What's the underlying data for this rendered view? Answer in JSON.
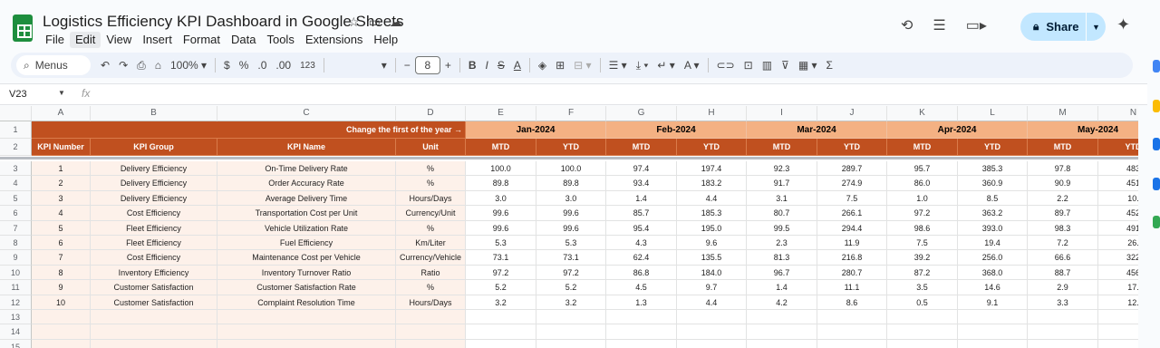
{
  "doc": {
    "title": "Logistics Efficiency KPI Dashboard in Google Sheets"
  },
  "menu": [
    "File",
    "Edit",
    "View",
    "Insert",
    "Format",
    "Data",
    "Tools",
    "Extensions",
    "Help"
  ],
  "share": {
    "label": "Share"
  },
  "toolbar": {
    "menus": "Menus",
    "zoom": "100%",
    "currency": "$",
    "percent": "%",
    "dec_dec": ".0",
    "dec_inc": ".00",
    "number_format": "123",
    "font_size": "8"
  },
  "formula_bar": {
    "cell_ref": "V23",
    "fx": "fx"
  },
  "columns": [
    "A",
    "B",
    "C",
    "D",
    "E",
    "F",
    "G",
    "H",
    "I",
    "J",
    "K",
    "L",
    "M",
    "N"
  ],
  "banner": {
    "text": "Change the first of the year →"
  },
  "months": [
    "Jan-2024",
    "Feb-2024",
    "Mar-2024",
    "Apr-2024",
    "May-2024"
  ],
  "headers": {
    "kpi_number": "KPI Number",
    "kpi_group": "KPI Group",
    "kpi_name": "KPI Name",
    "unit": "Unit",
    "mtd": "MTD",
    "ytd": "YTD"
  },
  "row_numbers": [
    "1",
    "2",
    "3",
    "4",
    "5",
    "6",
    "7",
    "8",
    "9",
    "10",
    "11",
    "12",
    "13",
    "14",
    "15"
  ],
  "rows": [
    {
      "num": "1",
      "group": "Delivery Efficiency",
      "name": "On-Time Delivery Rate",
      "unit": "%",
      "vals": [
        "100.0",
        "100.0",
        "97.4",
        "197.4",
        "92.3",
        "289.7",
        "95.7",
        "385.3",
        "97.8",
        "483"
      ]
    },
    {
      "num": "2",
      "group": "Delivery Efficiency",
      "name": "Order Accuracy Rate",
      "unit": "%",
      "vals": [
        "89.8",
        "89.8",
        "93.4",
        "183.2",
        "91.7",
        "274.9",
        "86.0",
        "360.9",
        "90.9",
        "451"
      ]
    },
    {
      "num": "3",
      "group": "Delivery Efficiency",
      "name": "Average Delivery Time",
      "unit": "Hours/Days",
      "vals": [
        "3.0",
        "3.0",
        "1.4",
        "4.4",
        "3.1",
        "7.5",
        "1.0",
        "8.5",
        "2.2",
        "10."
      ]
    },
    {
      "num": "4",
      "group": "Cost Efficiency",
      "name": "Transportation Cost per Unit",
      "unit": "Currency/Unit",
      "vals": [
        "99.6",
        "99.6",
        "85.7",
        "185.3",
        "80.7",
        "266.1",
        "97.2",
        "363.2",
        "89.7",
        "452"
      ]
    },
    {
      "num": "5",
      "group": "Fleet Efficiency",
      "name": "Vehicle Utilization Rate",
      "unit": "%",
      "vals": [
        "99.6",
        "99.6",
        "95.4",
        "195.0",
        "99.5",
        "294.4",
        "98.6",
        "393.0",
        "98.3",
        "491"
      ]
    },
    {
      "num": "6",
      "group": "Fleet Efficiency",
      "name": "Fuel Efficiency",
      "unit": "Km/Liter",
      "vals": [
        "5.3",
        "5.3",
        "4.3",
        "9.6",
        "2.3",
        "11.9",
        "7.5",
        "19.4",
        "7.2",
        "26."
      ]
    },
    {
      "num": "7",
      "group": "Cost Efficiency",
      "name": "Maintenance Cost per Vehicle",
      "unit": "Currency/Vehicle",
      "vals": [
        "73.1",
        "73.1",
        "62.4",
        "135.5",
        "81.3",
        "216.8",
        "39.2",
        "256.0",
        "66.6",
        "322"
      ]
    },
    {
      "num": "8",
      "group": "Inventory Efficiency",
      "name": "Inventory Turnover Ratio",
      "unit": "Ratio",
      "vals": [
        "97.2",
        "97.2",
        "86.8",
        "184.0",
        "96.7",
        "280.7",
        "87.2",
        "368.0",
        "88.7",
        "456"
      ]
    },
    {
      "num": "9",
      "group": "Customer Satisfaction",
      "name": "Customer Satisfaction Rate",
      "unit": "%",
      "vals": [
        "5.2",
        "5.2",
        "4.5",
        "9.7",
        "1.4",
        "11.1",
        "3.5",
        "14.6",
        "2.9",
        "17."
      ]
    },
    {
      "num": "10",
      "group": "Customer Satisfaction",
      "name": "Complaint Resolution Time",
      "unit": "Hours/Days",
      "vals": [
        "3.2",
        "3.2",
        "1.3",
        "4.4",
        "4.2",
        "8.6",
        "0.5",
        "9.1",
        "3.3",
        "12."
      ]
    }
  ]
}
